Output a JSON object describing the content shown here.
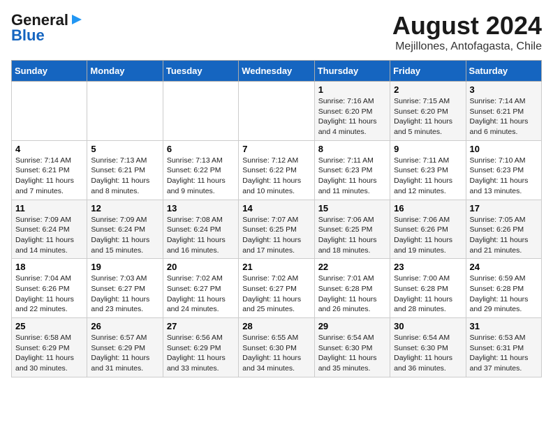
{
  "header": {
    "logo_line1": "General",
    "logo_line2": "Blue",
    "title": "August 2024",
    "subtitle": "Mejillones, Antofagasta, Chile"
  },
  "weekdays": [
    "Sunday",
    "Monday",
    "Tuesday",
    "Wednesday",
    "Thursday",
    "Friday",
    "Saturday"
  ],
  "weeks": [
    [
      {
        "day": "",
        "info": ""
      },
      {
        "day": "",
        "info": ""
      },
      {
        "day": "",
        "info": ""
      },
      {
        "day": "",
        "info": ""
      },
      {
        "day": "1",
        "info": "Sunrise: 7:16 AM\nSunset: 6:20 PM\nDaylight: 11 hours\nand 4 minutes."
      },
      {
        "day": "2",
        "info": "Sunrise: 7:15 AM\nSunset: 6:20 PM\nDaylight: 11 hours\nand 5 minutes."
      },
      {
        "day": "3",
        "info": "Sunrise: 7:14 AM\nSunset: 6:21 PM\nDaylight: 11 hours\nand 6 minutes."
      }
    ],
    [
      {
        "day": "4",
        "info": "Sunrise: 7:14 AM\nSunset: 6:21 PM\nDaylight: 11 hours\nand 7 minutes."
      },
      {
        "day": "5",
        "info": "Sunrise: 7:13 AM\nSunset: 6:21 PM\nDaylight: 11 hours\nand 8 minutes."
      },
      {
        "day": "6",
        "info": "Sunrise: 7:13 AM\nSunset: 6:22 PM\nDaylight: 11 hours\nand 9 minutes."
      },
      {
        "day": "7",
        "info": "Sunrise: 7:12 AM\nSunset: 6:22 PM\nDaylight: 11 hours\nand 10 minutes."
      },
      {
        "day": "8",
        "info": "Sunrise: 7:11 AM\nSunset: 6:23 PM\nDaylight: 11 hours\nand 11 minutes."
      },
      {
        "day": "9",
        "info": "Sunrise: 7:11 AM\nSunset: 6:23 PM\nDaylight: 11 hours\nand 12 minutes."
      },
      {
        "day": "10",
        "info": "Sunrise: 7:10 AM\nSunset: 6:23 PM\nDaylight: 11 hours\nand 13 minutes."
      }
    ],
    [
      {
        "day": "11",
        "info": "Sunrise: 7:09 AM\nSunset: 6:24 PM\nDaylight: 11 hours\nand 14 minutes."
      },
      {
        "day": "12",
        "info": "Sunrise: 7:09 AM\nSunset: 6:24 PM\nDaylight: 11 hours\nand 15 minutes."
      },
      {
        "day": "13",
        "info": "Sunrise: 7:08 AM\nSunset: 6:24 PM\nDaylight: 11 hours\nand 16 minutes."
      },
      {
        "day": "14",
        "info": "Sunrise: 7:07 AM\nSunset: 6:25 PM\nDaylight: 11 hours\nand 17 minutes."
      },
      {
        "day": "15",
        "info": "Sunrise: 7:06 AM\nSunset: 6:25 PM\nDaylight: 11 hours\nand 18 minutes."
      },
      {
        "day": "16",
        "info": "Sunrise: 7:06 AM\nSunset: 6:26 PM\nDaylight: 11 hours\nand 19 minutes."
      },
      {
        "day": "17",
        "info": "Sunrise: 7:05 AM\nSunset: 6:26 PM\nDaylight: 11 hours\nand 21 minutes."
      }
    ],
    [
      {
        "day": "18",
        "info": "Sunrise: 7:04 AM\nSunset: 6:26 PM\nDaylight: 11 hours\nand 22 minutes."
      },
      {
        "day": "19",
        "info": "Sunrise: 7:03 AM\nSunset: 6:27 PM\nDaylight: 11 hours\nand 23 minutes."
      },
      {
        "day": "20",
        "info": "Sunrise: 7:02 AM\nSunset: 6:27 PM\nDaylight: 11 hours\nand 24 minutes."
      },
      {
        "day": "21",
        "info": "Sunrise: 7:02 AM\nSunset: 6:27 PM\nDaylight: 11 hours\nand 25 minutes."
      },
      {
        "day": "22",
        "info": "Sunrise: 7:01 AM\nSunset: 6:28 PM\nDaylight: 11 hours\nand 26 minutes."
      },
      {
        "day": "23",
        "info": "Sunrise: 7:00 AM\nSunset: 6:28 PM\nDaylight: 11 hours\nand 28 minutes."
      },
      {
        "day": "24",
        "info": "Sunrise: 6:59 AM\nSunset: 6:28 PM\nDaylight: 11 hours\nand 29 minutes."
      }
    ],
    [
      {
        "day": "25",
        "info": "Sunrise: 6:58 AM\nSunset: 6:29 PM\nDaylight: 11 hours\nand 30 minutes."
      },
      {
        "day": "26",
        "info": "Sunrise: 6:57 AM\nSunset: 6:29 PM\nDaylight: 11 hours\nand 31 minutes."
      },
      {
        "day": "27",
        "info": "Sunrise: 6:56 AM\nSunset: 6:29 PM\nDaylight: 11 hours\nand 33 minutes."
      },
      {
        "day": "28",
        "info": "Sunrise: 6:55 AM\nSunset: 6:30 PM\nDaylight: 11 hours\nand 34 minutes."
      },
      {
        "day": "29",
        "info": "Sunrise: 6:54 AM\nSunset: 6:30 PM\nDaylight: 11 hours\nand 35 minutes."
      },
      {
        "day": "30",
        "info": "Sunrise: 6:54 AM\nSunset: 6:30 PM\nDaylight: 11 hours\nand 36 minutes."
      },
      {
        "day": "31",
        "info": "Sunrise: 6:53 AM\nSunset: 6:31 PM\nDaylight: 11 hours\nand 37 minutes."
      }
    ]
  ]
}
